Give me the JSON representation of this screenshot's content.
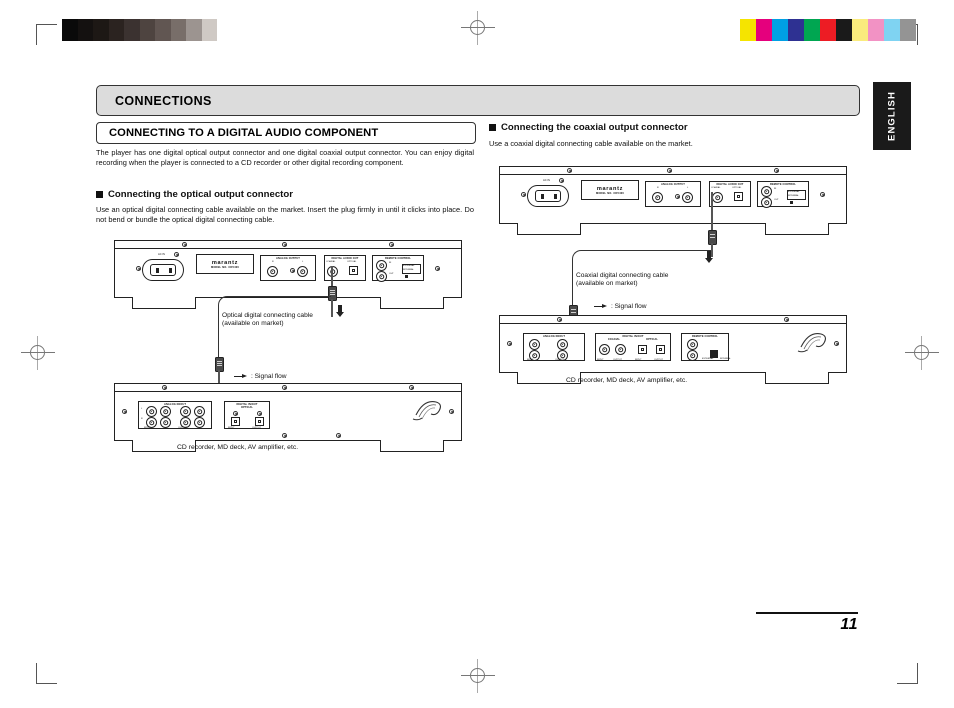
{
  "document": {
    "language_tab": "ENGLISH",
    "page_number": "11"
  },
  "header": {
    "chapter_title": "CONNECTIONS",
    "section_title": "CONNECTING TO A DIGITAL AUDIO COMPONENT",
    "intro_paragraph": "The player has one digital optical output connector and one digital coaxial output connector. You can enjoy digital recording when the player is connected to a CD recorder or other digital recording component."
  },
  "left_column": {
    "heading": "Connecting the optical output connector",
    "body": "Use an optical digital connecting cable available on the market.  Insert the plug firmly in until it clicks into place.  Do not bend or bundle the optical digital connecting cable.",
    "cable_callout_line1": "Optical digital connecting cable",
    "cable_callout_line2": "(available on market)",
    "signal_flow_label": ": Signal flow",
    "device_caption": "CD recorder, MD deck, AV amplifier, etc."
  },
  "right_column": {
    "heading": "Connecting the coaxial output connector",
    "body": "Use a coaxial digital connecting cable available on the market.",
    "cable_callout_line1": "Coaxial digital connecting cable",
    "cable_callout_line2": "(available on market)",
    "signal_flow_label": ": Signal flow",
    "device_caption": "CD recorder, MD deck, AV amplifier, etc."
  },
  "player_panel": {
    "brand": "marantz",
    "model": "MODEL NO. CD5400",
    "ac_inlet_label": "AC IN",
    "analog_output_label": "ANALOG OUTPUT",
    "analog_r": "R",
    "analog_l": "L",
    "digital_out_label": "DIGITAL AUDIO OUT",
    "coaxial_label": "COAXIAL",
    "optical_label": "OPTICAL",
    "remote_control_label": "REMOTE CONTROL",
    "remote_in": "IN",
    "remote_out": "OUT",
    "external_label": "EXTERNAL",
    "internal_label": "INTERNAL"
  },
  "recorder_panel_optical": {
    "analog_label": "ANALOG IN/OUT",
    "digital_label": "DIGITAL IN/OUT",
    "optical_label": "OPTICAL",
    "input_label": "INPUT",
    "output_label": "OUTPUT",
    "ch_l": "L",
    "ch_r": "R"
  },
  "recorder_panel_coaxial": {
    "analog_label": "ANALOG IN/OUT",
    "digital_label": "DIGITAL IN/OUT",
    "coaxial_label": "COAXIAL",
    "optical_label": "OPTICAL",
    "input_label": "INPUT",
    "output_label": "OUTPUT",
    "remote_label": "REMOTE CONTROL",
    "external_label": "EXTERNAL",
    "internal_label": "INTERNAL"
  },
  "print_marks": {
    "grey_wedge": [
      "#0a0a0a",
      "#141110",
      "#1d1815",
      "#2b2320",
      "#3b3230",
      "#4e4440",
      "#615652",
      "#786e69",
      "#9c9490",
      "#cfc9c4",
      "#ffffff"
    ],
    "color_bars": [
      "#f5e400",
      "#e5007d",
      "#00a0e4",
      "#2e3192",
      "#00a651",
      "#ed1c24",
      "#1a1a1a",
      "#faec7e",
      "#f292c4",
      "#7fd3f2",
      "#949494"
    ]
  }
}
